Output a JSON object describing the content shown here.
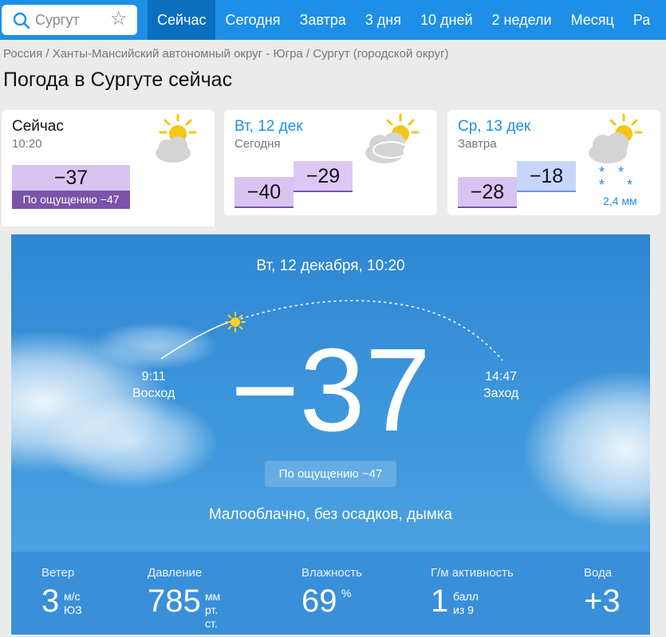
{
  "search": {
    "placeholder": "Сургут"
  },
  "nav": {
    "items": [
      "Сейчас",
      "Сегодня",
      "Завтра",
      "3 дня",
      "10 дней",
      "2 недели",
      "Месяц",
      "Ра"
    ]
  },
  "breadcrumb": "Россия / Ханты-Мансийский автономный округ - Югра / Сургут (городской округ)",
  "page_title": "Погода в Сургуте сейчас",
  "cards": {
    "now": {
      "title": "Сейчас",
      "time": "10:20",
      "temp": "−37",
      "feels": "По ощущению −47"
    },
    "today": {
      "title": "Вт, 12 дек",
      "sub": "Сегодня",
      "min": "−40",
      "max": "−29"
    },
    "tomorrow": {
      "title": "Ср, 13 дек",
      "sub": "Завтра",
      "min": "−28",
      "max": "−18",
      "precip": "2,4 мм"
    }
  },
  "current": {
    "date": "Вт, 12 декабря, 10:20",
    "temp": "−37",
    "sunrise_time": "9:11",
    "sunrise_label": "Восход",
    "sunset_time": "14:47",
    "sunset_label": "Заход",
    "feels": "По ощущению −47",
    "condition": "Малооблачно, без осадков, дымка"
  },
  "stats": {
    "wind": {
      "label": "Ветер",
      "value": "3",
      "unit1": "м/с",
      "unit2": "ЮЗ"
    },
    "pressure": {
      "label": "Давление",
      "value": "785",
      "unit1": "мм",
      "unit2": "рт. ст."
    },
    "humidity": {
      "label": "Влажность",
      "value": "69",
      "unit1": "%"
    },
    "geomag": {
      "label": "Г/м активность",
      "value": "1",
      "unit1": "балл",
      "unit2": "из 9"
    },
    "water": {
      "label": "Вода",
      "value": "+3"
    }
  },
  "colors": {
    "brand_blue": "#1e8fe6",
    "active_tab": "#0a6fbf",
    "feels_purple": "#7b53a8"
  }
}
